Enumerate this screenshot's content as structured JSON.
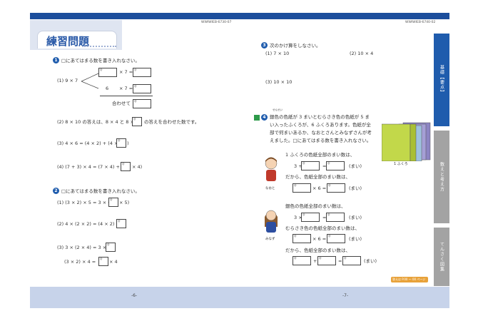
{
  "header": {
    "left_code": "WWIWIEB-6730-07",
    "right_code": "WWIWIEB-6740-02"
  },
  "title": {
    "kanji_part": "練習",
    "rest": "問題"
  },
  "q1": {
    "number": "1",
    "instruction": "□にあてはまる数を書き入れなさい。",
    "p1": {
      "label": "(1) 9 × 7",
      "r1": "× 7 =",
      "r2_left": "6",
      "r2": "× 7 =",
      "sum": "合わせて"
    },
    "p2": {
      "text_a": "(2) 8 × 10 の答えは、8 × 4 と 8 ×",
      "text_b": "の答えを合わせた数です。"
    },
    "p3": {
      "text": "(3) 4 × 6 = (4 × 2) + (4 ×",
      "close": ")"
    },
    "p4": {
      "text": "(4) (7 + 3) × 4 = (7 × 4) + (",
      "close": "× 4)"
    }
  },
  "q2": {
    "number": "2",
    "instruction": "□にあてはまる数を書き入れなさい。",
    "p1": {
      "text": "(1) (3 × 2) × 5 = 3 × (",
      "close": "× 5)"
    },
    "p2": {
      "text": "(2) 4 × (2 × 2) = (4 × 2) ×"
    },
    "p3": {
      "line1": "(3) 3 × (2 × 4) = 3 ×",
      "line2": "(3 × 2) × 4 =",
      "line2_end": "× 4"
    }
  },
  "q3": {
    "number": "3",
    "instruction": "次のかけ算をしなさい。",
    "items": [
      "(1) 7 × 10",
      "(2) 10 × 4",
      "(3) 10 × 10"
    ]
  },
  "q4": {
    "number": "4",
    "furigana": "せんせい",
    "line1": "銀色の色紙が 3 まいとむらさき色の色紙が 5 ま",
    "line2": "い入ったふくろが、6 ふくろあります。色紙が全",
    "line3": "部で何まいあるか、なおとさんとみなずさんが考",
    "line4": "えました。□にあてはまる数を書き入れなさい。",
    "bag_label": "1 ふくろ",
    "naoto": {
      "name": "なおと",
      "s1": "1 ふくろの色紙全部のまい数は、",
      "eq1a": "3 +",
      "eq1b": "=",
      "unit": "(まい)",
      "s2": "だから、色紙全部のまい数は、",
      "eq2": "× 6 ="
    },
    "minazu": {
      "name": "みなず",
      "s1": "銀色の色紙全部のまい数は、",
      "eq1a": "3 ×",
      "eq1b": "=",
      "s2": "むらさき色の色紙全部のまい数は、",
      "eq2": "× 6 =",
      "s3": "だから、色紙全部のまい数は、",
      "plus": "+",
      "eq3": "="
    }
  },
  "side_tabs": [
    "基礎【要点】",
    "数えと考え方",
    "てんさく図集"
  ],
  "bottom_badge": "答えは P.00 ～ 00 ページ",
  "page_numbers": {
    "left": "-6-",
    "right": "-7-"
  },
  "box_hint": "□"
}
